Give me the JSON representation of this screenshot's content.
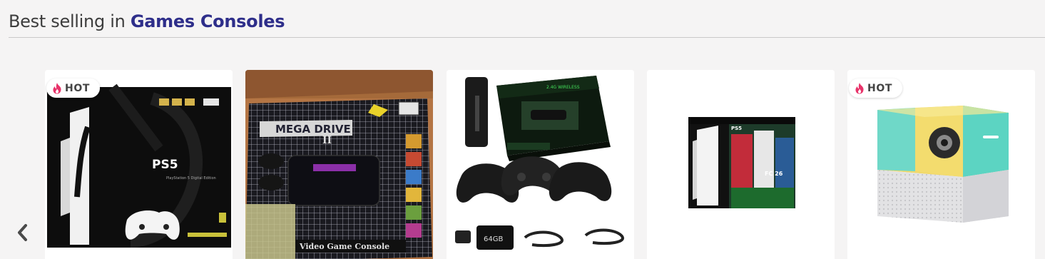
{
  "header": {
    "prefix": "Best selling in ",
    "category": "Games Consoles"
  },
  "carousel": {
    "prev_icon": "chevron-left-icon",
    "products": [
      {
        "name": "ps5-slim-digital-edition",
        "badge": "HOT",
        "box_brand": "PS5",
        "box_caption": "PlayStation 5 Digital Edition"
      },
      {
        "name": "mega-drive-ii-video-game-console",
        "badge": "",
        "box_brand": "MEGA DRIVE",
        "box_caption": "Video Game Console"
      },
      {
        "name": "wireless-retro-game-stick-bundle",
        "badge": "",
        "box_brand": "2.4G WIRELESS",
        "box_caption": "64GB"
      },
      {
        "name": "ps5-slim-ea-fc-bundle",
        "badge": "",
        "box_brand": "PS5",
        "box_caption": "FC 26"
      },
      {
        "name": "cube-mini-projector",
        "badge": "HOT",
        "box_brand": "",
        "box_caption": ""
      }
    ]
  },
  "colors": {
    "title_accent": "#2e2e8a",
    "hot_flame": "#e8336a",
    "background": "#f5f4f4"
  }
}
